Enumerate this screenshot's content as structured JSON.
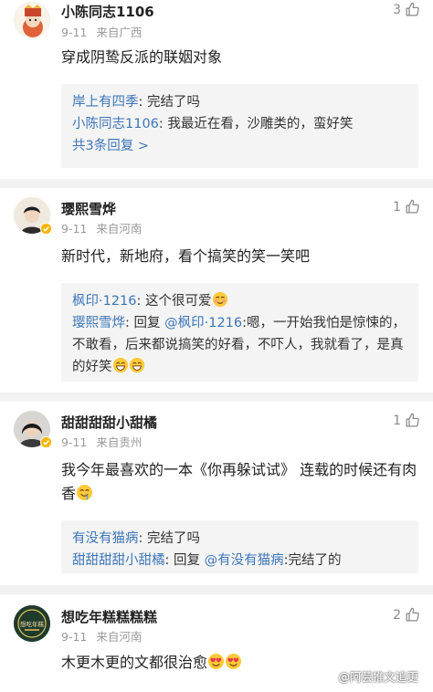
{
  "comments": [
    {
      "username": "小陈同志1106",
      "date": "9-11",
      "location": "来自广西",
      "likes": "3",
      "text": "穿成阴鸷反派的联姻对象",
      "replies": [
        {
          "name": "岸上有四季",
          "text": ": 完结了吗"
        },
        {
          "name": "小陈同志1106",
          "text": ": 我最近在看，沙雕类的，蛮好笑"
        }
      ],
      "more": "共3条回复 >"
    },
    {
      "username": "璎熙雪烨",
      "date": "9-11",
      "location": "来自河南",
      "likes": "1",
      "text": "新时代，新地府，看个搞笑的笑一笑吧",
      "replies": [
        {
          "name": "枫印·1216",
          "text": ": 这个很可爱"
        },
        {
          "name": "璎熙雪烨",
          "text": ": 回复 ",
          "mention": "@枫印·1216",
          "tail": ":嗯，一开始我怕是惊悚的，不敢看，后来都说搞笑的好看，不吓人，我就看了，是真的好笑"
        }
      ]
    },
    {
      "username": "甜甜甜甜小甜橘",
      "date": "9-11",
      "location": "来自贵州",
      "likes": "1",
      "text": "我今年最喜欢的一本《你再躲试试》 连载的时候还有肉香",
      "replies": [
        {
          "name": "有没有猫病",
          "text": ": 完结了吗"
        },
        {
          "name": "甜甜甜甜小甜橘",
          "text": ": 回复 ",
          "mention": "@有没有猫病",
          "tail": ":完结了的"
        }
      ]
    },
    {
      "username": "想吃年糕糕糕糕",
      "date": "9-11",
      "location": "来自河南",
      "likes": "2",
      "text": "木更木更的文都很治愈",
      "avatar_text": "想吃年糕"
    }
  ],
  "watermark": "@阿芸推文追更",
  "colors": {
    "link": "#3d76b8",
    "reply_bg": "#f4f4f4",
    "separator": "#f2f2f2",
    "meta": "#9a9a9a"
  }
}
